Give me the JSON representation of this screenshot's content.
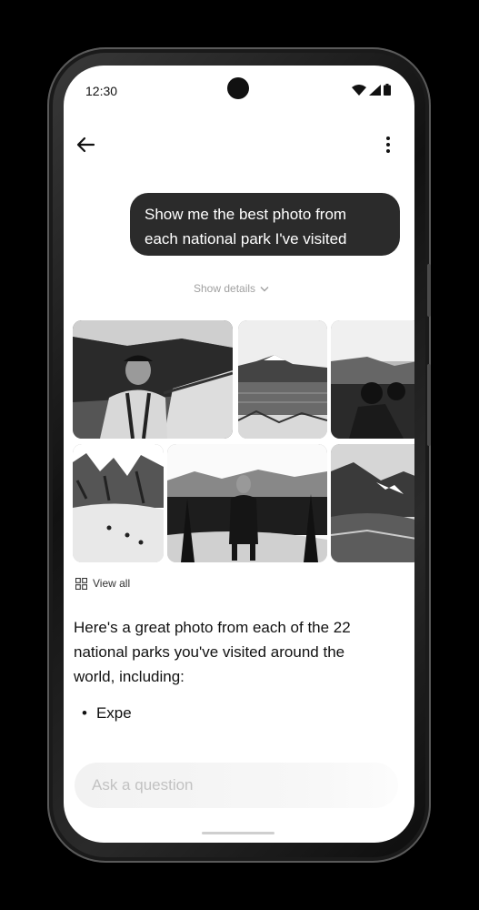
{
  "status_bar": {
    "time": "12:30"
  },
  "header": {
    "back_icon": "arrow-left-icon",
    "menu_icon": "more-vert-icon"
  },
  "user_message": {
    "lines": [
      "Show me the best photo from",
      "each national park I've visited"
    ]
  },
  "show_details": {
    "label": "Show details",
    "icon": "chevron-down-icon"
  },
  "photos": [
    {
      "subject": "selfie-canyon-overlook"
    },
    {
      "subject": "lake-with-mountains"
    },
    {
      "subject": "sunset-silhouettes"
    },
    {
      "subject": "snowy-valley-hikers"
    },
    {
      "subject": "person-at-crater-lake"
    },
    {
      "subject": "rocky-mountain-snow"
    }
  ],
  "view_all": {
    "label": "View all",
    "icon": "grid-icon"
  },
  "answer": {
    "lines": [
      "Here's a great photo from each of the 22",
      "national parks you've visited around the",
      "world, including:"
    ],
    "bullet_text": "Expe"
  },
  "input": {
    "placeholder": "Ask a question",
    "value": ""
  }
}
